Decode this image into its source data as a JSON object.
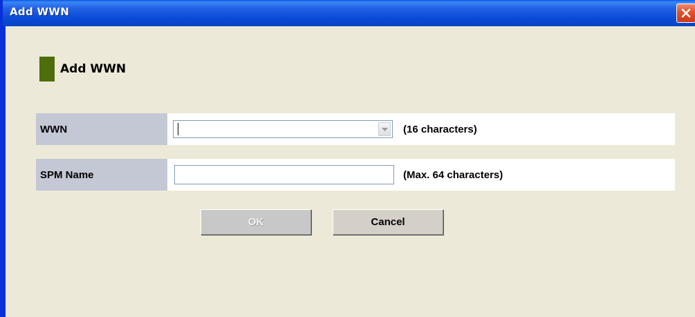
{
  "window": {
    "title": "Add WWN"
  },
  "heading": {
    "text": "Add WWN",
    "marker_color": "#4E6E0D"
  },
  "form": {
    "wwn": {
      "label": "WWN",
      "value": "",
      "hint": "(16 characters)"
    },
    "spm_name": {
      "label": "SPM Name",
      "value": "",
      "hint": "(Max. 64 characters)"
    }
  },
  "buttons": {
    "ok_label": "OK",
    "ok_enabled": false,
    "cancel_label": "Cancel"
  },
  "icons": {
    "close": "close-icon",
    "dropdown": "chevron-down-icon"
  }
}
